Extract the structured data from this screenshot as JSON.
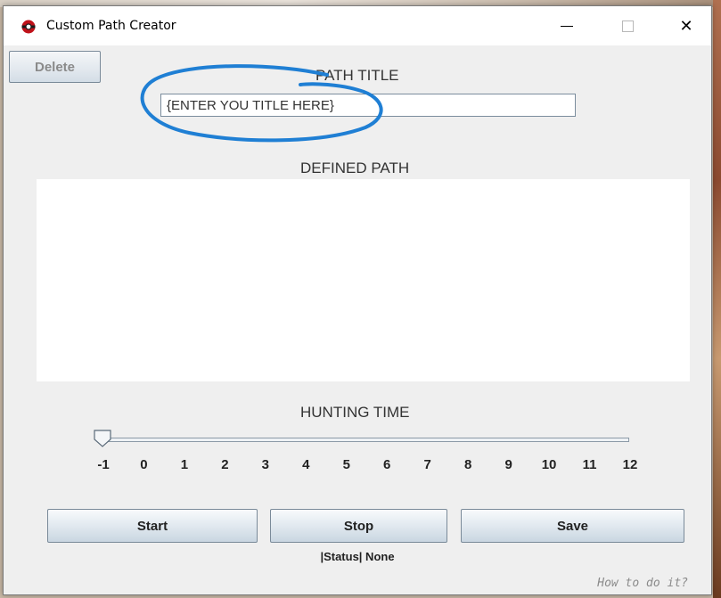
{
  "window": {
    "title": "Custom Path Creator",
    "close_glyph": "✕"
  },
  "toolbar": {
    "delete_label": "Delete"
  },
  "path_title": {
    "label": "PATH TITLE",
    "input_value": "{ENTER YOU TITLE HERE}"
  },
  "defined_path": {
    "label": "DEFINED PATH"
  },
  "hunting_time": {
    "label": "HUNTING TIME",
    "slider_value": -1,
    "slider_min": -1,
    "slider_max": 12,
    "ticks": [
      "-1",
      "0",
      "1",
      "2",
      "3",
      "4",
      "5",
      "6",
      "7",
      "8",
      "9",
      "10",
      "11",
      "12"
    ]
  },
  "actions": {
    "start_label": "Start",
    "stop_label": "Stop",
    "save_label": "Save"
  },
  "status": {
    "text": "|Status| None"
  },
  "help": {
    "link_text": "How to do it?"
  },
  "colors": {
    "annotation_stroke": "#1f7fd4",
    "button_border": "#7a8a99",
    "window_bg": "#efefef"
  }
}
